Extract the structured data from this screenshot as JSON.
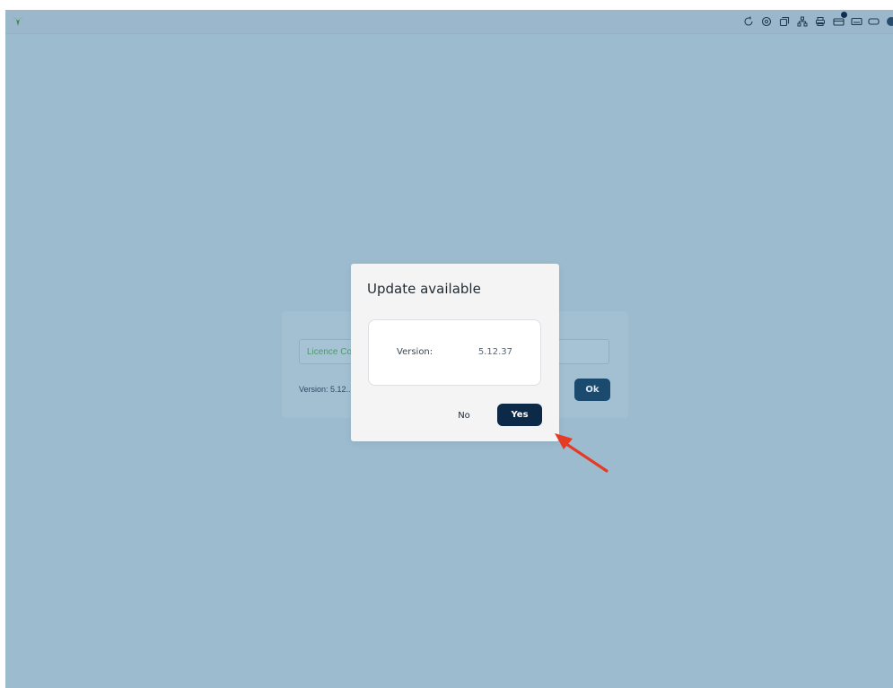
{
  "topbar": {
    "icons": [
      "refresh-icon",
      "settings-icon",
      "windows-icon",
      "network-icon",
      "printer-icon",
      "card-reader-icon",
      "keyboard-icon",
      "battery-icon",
      "status-dot-icon"
    ],
    "accent_color": "#0e2f4f"
  },
  "licence_card": {
    "input_placeholder": "Licence Co",
    "version_text": "Version: 5.12..",
    "ok_label": "Ok"
  },
  "modal": {
    "title": "Update available",
    "version_label": "Version:",
    "version_value": "5.12.37",
    "no_label": "No",
    "yes_label": "Yes"
  },
  "colors": {
    "background": "#9dbbcf",
    "primary_button": "#0c2a47",
    "annotation_arrow": "#e53a23"
  }
}
